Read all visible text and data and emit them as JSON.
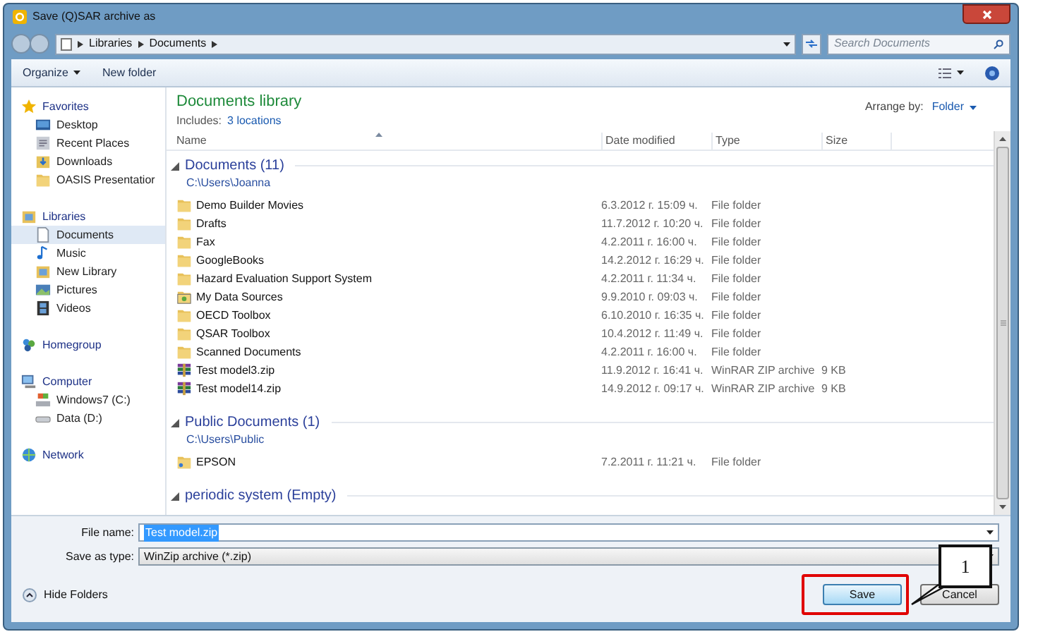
{
  "window": {
    "title": "Save (Q)SAR archive as"
  },
  "address": {
    "crumbs": [
      "Libraries",
      "Documents"
    ]
  },
  "search": {
    "placeholder": "Search Documents"
  },
  "toolbar": {
    "organize": "Organize",
    "new_folder": "New folder"
  },
  "sidebar": {
    "sections": [
      {
        "label": "Favorites",
        "kind": "star",
        "selected": false,
        "children": [
          {
            "label": "Desktop",
            "kind": "desktop",
            "selected": false
          },
          {
            "label": "Recent Places",
            "kind": "recent",
            "selected": false
          },
          {
            "label": "Downloads",
            "kind": "downloads",
            "selected": false
          },
          {
            "label": "OASIS Presentatior",
            "kind": "folder",
            "selected": false
          }
        ]
      },
      {
        "label": "Libraries",
        "kind": "library",
        "selected": false,
        "children": [
          {
            "label": "Documents",
            "kind": "document",
            "selected": true
          },
          {
            "label": "Music",
            "kind": "music",
            "selected": false
          },
          {
            "label": "New Library",
            "kind": "library",
            "selected": false
          },
          {
            "label": "Pictures",
            "kind": "pictures",
            "selected": false
          },
          {
            "label": "Videos",
            "kind": "videos",
            "selected": false
          }
        ]
      },
      {
        "label": "Homegroup",
        "kind": "homegroup",
        "selected": false
      },
      {
        "label": "Computer",
        "kind": "computer",
        "selected": false,
        "children": [
          {
            "label": "Windows7 (C:)",
            "kind": "drive",
            "selected": false
          },
          {
            "label": "Data (D:)",
            "kind": "disk",
            "selected": false
          }
        ]
      },
      {
        "label": "Network",
        "kind": "network",
        "selected": false
      }
    ]
  },
  "library": {
    "title": "Documents library",
    "includes_label": "Includes:",
    "includes_link": "3 locations",
    "arrange_label": "Arrange by:",
    "arrange_value": "Folder"
  },
  "table": {
    "columns": [
      "Name",
      "Date modified",
      "Type",
      "Size"
    ]
  },
  "groups": [
    {
      "title": "Documents (11)",
      "path": "C:\\Users\\Joanna",
      "expanded": true,
      "rows": [
        {
          "name": "Demo Builder Movies",
          "kind": "folder",
          "date": "6.3.2012 г. 15:09 ч.",
          "type": "File folder"
        },
        {
          "name": "Drafts",
          "kind": "folder",
          "date": "11.7.2012 г. 10:20 ч.",
          "type": "File folder"
        },
        {
          "name": "Fax",
          "kind": "folder",
          "date": "4.2.2011 г. 16:00 ч.",
          "type": "File folder"
        },
        {
          "name": "GoogleBooks",
          "kind": "folder",
          "date": "14.2.2012 г. 16:29 ч.",
          "type": "File folder"
        },
        {
          "name": "Hazard Evaluation Support System",
          "kind": "folder",
          "date": "4.2.2011 г. 11:34 ч.",
          "type": "File folder"
        },
        {
          "name": "My Data Sources",
          "kind": "datasource",
          "date": "9.9.2010 г. 09:03 ч.",
          "type": "File folder"
        },
        {
          "name": "OECD Toolbox",
          "kind": "folder",
          "date": "6.10.2010 г. 16:35 ч.",
          "type": "File folder"
        },
        {
          "name": "QSAR Toolbox",
          "kind": "folder",
          "date": "10.4.2012 г. 11:49 ч.",
          "type": "File folder"
        },
        {
          "name": "Scanned Documents",
          "kind": "folder",
          "date": "4.2.2011 г. 16:00 ч.",
          "type": "File folder"
        },
        {
          "name": "Test model3.zip",
          "kind": "zip",
          "date": "11.9.2012 г. 16:41 ч.",
          "type": "WinRAR ZIP archive",
          "size": "9 KB"
        },
        {
          "name": "Test model14.zip",
          "kind": "zip",
          "date": "14.9.2012 г. 09:17 ч.",
          "type": "WinRAR ZIP archive",
          "size": "9 KB"
        }
      ]
    },
    {
      "title": "Public Documents (1)",
      "path": "C:\\Users\\Public",
      "expanded": true,
      "rows": [
        {
          "name": "EPSON",
          "kind": "shared",
          "date": "7.2.2011 г. 11:21 ч.",
          "type": "File folder"
        }
      ]
    },
    {
      "title": "periodic system (Empty)",
      "expanded": true
    }
  ],
  "file_name": {
    "label": "File name:",
    "value": "Test model.zip",
    "highlighted": true
  },
  "save_type": {
    "label": "Save as type:",
    "value": "WinZip archive (*.zip)"
  },
  "hide_folders": "Hide Folders",
  "buttons": [
    {
      "label": "Save",
      "default": true,
      "highlighted": true
    },
    {
      "label": "Cancel",
      "default": false,
      "highlighted": false
    }
  ],
  "callout": {
    "label": "1"
  }
}
